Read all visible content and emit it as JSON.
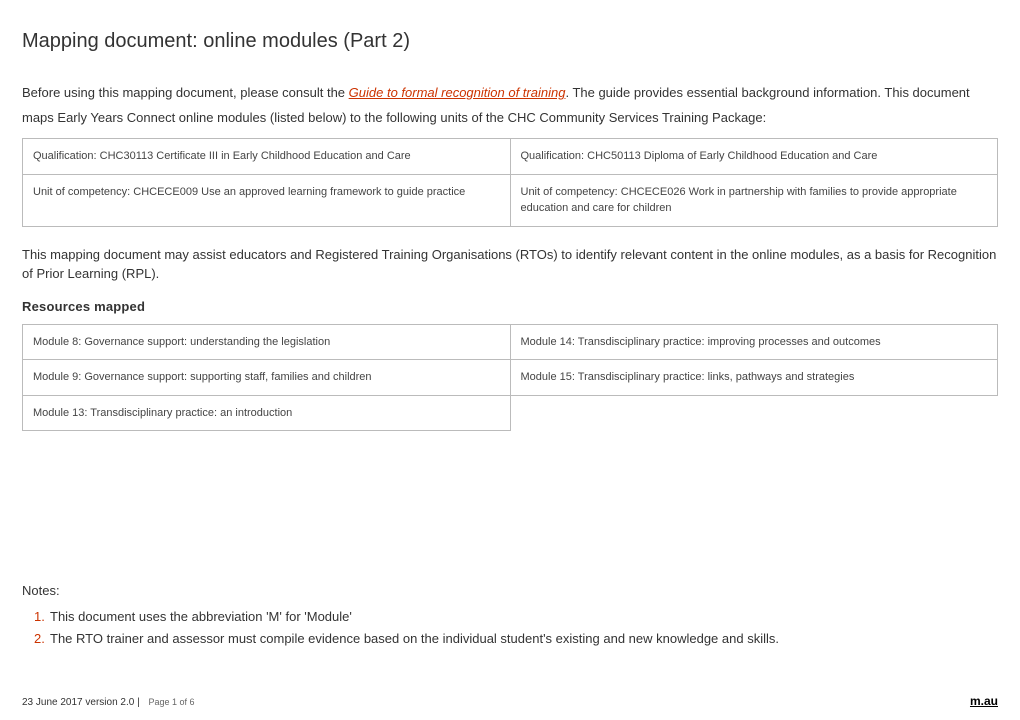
{
  "title": "Mapping document: online modules (Part 2)",
  "intro": {
    "before_link": "Before using this mapping document, please consult the ",
    "link_text": "Guide to formal recognition of training",
    "after_link": ". The guide provides essential background information. This document maps Early Years Connect online modules (listed below) to the following units of the CHC Community Services Training Package:"
  },
  "qual_table": {
    "r1c1": "Qualification: CHC30113 Certificate III in Early Childhood Education and Care",
    "r1c2": "Qualification: CHC50113 Diploma of Early Childhood Education and Care",
    "r2c1": "Unit of competency: CHCECE009 Use an approved learning framework to guide practice",
    "r2c2": "Unit of competency: CHCECE026 Work in partnership with families to provide appropriate education and care for children"
  },
  "mid_text": "This mapping document may assist educators and Registered Training Organisations (RTOs) to identify relevant content in the online modules, as a basis for Recognition of Prior Learning (RPL).",
  "resources_heading": "Resources mapped",
  "resources_table": {
    "r1c1": "Module 8: Governance support: understanding the legislation",
    "r1c2": "Module 14: Transdisciplinary practice: improving processes and outcomes",
    "r2c1": "Module 9: Governance support: supporting staff, families and children",
    "r2c2": "Module 15: Transdisciplinary practice: links, pathways and strategies",
    "r3c1": "Module 13: Transdisciplinary practice: an introduction"
  },
  "notes": {
    "label": "Notes:",
    "items": [
      "This document uses the abbreviation 'M' for 'Module'",
      "The RTO trainer and assessor must compile evidence based on the individual student's existing and new knowledge and skills."
    ]
  },
  "footer": {
    "date_version": "23 June 2017 version 2.0",
    "page_info": "Page 1 of 6",
    "right": "m.au"
  }
}
